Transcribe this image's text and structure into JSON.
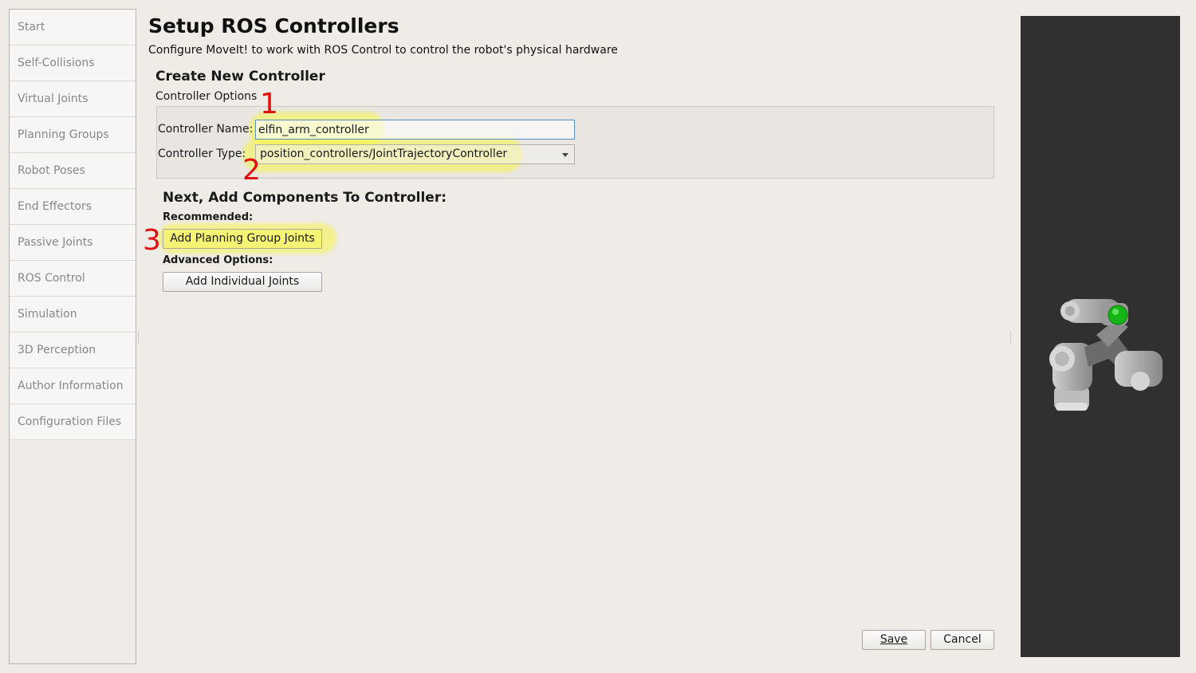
{
  "sidebar": {
    "items": [
      {
        "label": "Start"
      },
      {
        "label": "Self-Collisions"
      },
      {
        "label": "Virtual Joints"
      },
      {
        "label": "Planning Groups"
      },
      {
        "label": "Robot Poses"
      },
      {
        "label": "End Effectors"
      },
      {
        "label": "Passive Joints"
      },
      {
        "label": "ROS Control"
      },
      {
        "label": "Simulation"
      },
      {
        "label": "3D Perception"
      },
      {
        "label": "Author Information"
      },
      {
        "label": "Configuration Files"
      }
    ]
  },
  "header": {
    "title": "Setup ROS Controllers",
    "subtitle": "Configure MoveIt! to work with ROS Control to control the robot's physical hardware"
  },
  "create": {
    "section_title": "Create New Controller",
    "group_label": "Controller Options",
    "name_label": "Controller Name:",
    "name_value": "elfin_arm_controller",
    "type_label": "Controller Type:",
    "type_value": "position_controllers/JointTrajectoryController"
  },
  "components": {
    "title": "Next, Add Components To Controller:",
    "recommended_label": "Recommended:",
    "add_group_button": "Add Planning Group Joints",
    "advanced_label": "Advanced Options:",
    "add_individual_button": "Add Individual Joints"
  },
  "annotations": {
    "one": "1",
    "two": "2",
    "three": "3"
  },
  "footer": {
    "save_label": "Save",
    "cancel_label": "Cancel"
  },
  "colors": {
    "highlight": "#f6f646",
    "annotation": "#e01010",
    "viewer_bg": "#303030"
  }
}
